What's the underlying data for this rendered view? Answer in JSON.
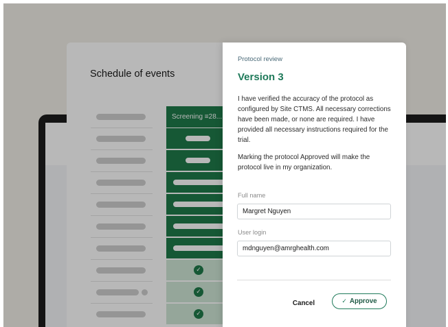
{
  "schedule": {
    "title": "Schedule of events",
    "column_header": "Screening ≡28...",
    "rows": 10
  },
  "modal": {
    "eyebrow": "Protocol review",
    "title": "Version 3",
    "paragraph1": "I have verified the accuracy of the protocol as configured by Site CTMS. All necessary corrections have been made, or none are required. I have provided all necessary instructions required for the trial.",
    "paragraph2": "Marking the protocol Approved will make the protocol live in my organization.",
    "full_name_label": "Full name",
    "full_name_value": "Margret Nguyen",
    "user_login_label": "User login",
    "user_login_value": "mdnguyen@amrghealth.com",
    "cancel_label": "Cancel",
    "approve_label": "Approve",
    "approve_icon": "check-icon"
  },
  "colors": {
    "accent_green": "#1f7a5a",
    "cell_green": "#1f7a4a",
    "cell_light_green": "#cfe6d6",
    "background": "#f1efe8"
  }
}
